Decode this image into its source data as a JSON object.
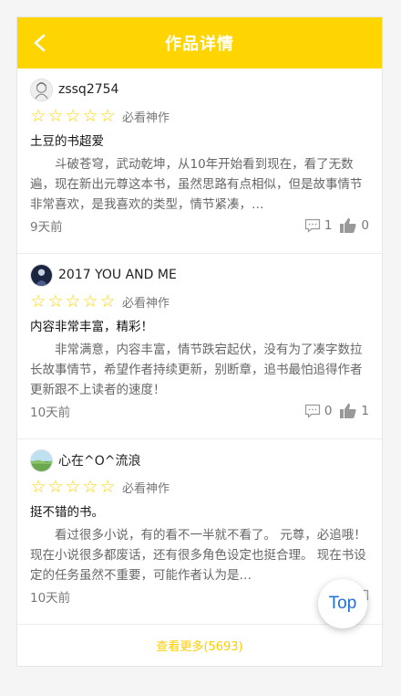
{
  "header": {
    "title": "作品详情",
    "back_icon": "chevron-left-icon"
  },
  "accent_color": "#ffd500",
  "reviews": [
    {
      "username": "zssq2754",
      "stars": [
        "☆",
        "☆",
        "☆",
        "☆",
        "☆"
      ],
      "rating_text": "必看神作",
      "title": "土豆的书超爱",
      "body": "斗破苍穹，武动乾坤，从10年开始看到现在，看了无数遍，现在新出元尊这本书，虽然思路有点相似，但是故事情节非常喜欢，是我喜欢的类型，情节紧凑，…",
      "time": "9天前",
      "comments": "1",
      "likes": "0"
    },
    {
      "username": "2017 YOU AND ME",
      "stars": [
        "☆",
        "☆",
        "☆",
        "☆",
        "☆"
      ],
      "rating_text": "必看神作",
      "title": "内容非常丰富，精彩！",
      "body": "非常满意，内容丰富，情节跌宕起伏，没有为了凑字数拉长故事情节，希望作者持续更新，别断章，追书最怕追得作者更新跟不上读者的速度！",
      "time": "10天前",
      "comments": "0",
      "likes": "1"
    },
    {
      "username": "心在^O^流浪",
      "stars": [
        "☆",
        "☆",
        "☆",
        "☆",
        "☆"
      ],
      "rating_text": "必看神作",
      "title": "挺不错的书。",
      "body": "看过很多小说，有的看不一半就不看了。 元尊，必追哦！ 现在小说很多都废话，还有很多角色设定也挺合理。 现在书设定的任务虽然不重要，可能作者认为是…",
      "time": "10天前",
      "comments": "",
      "likes": ""
    }
  ],
  "more": {
    "label": "查看更多(5693)"
  },
  "top_button": {
    "label": "Top"
  }
}
